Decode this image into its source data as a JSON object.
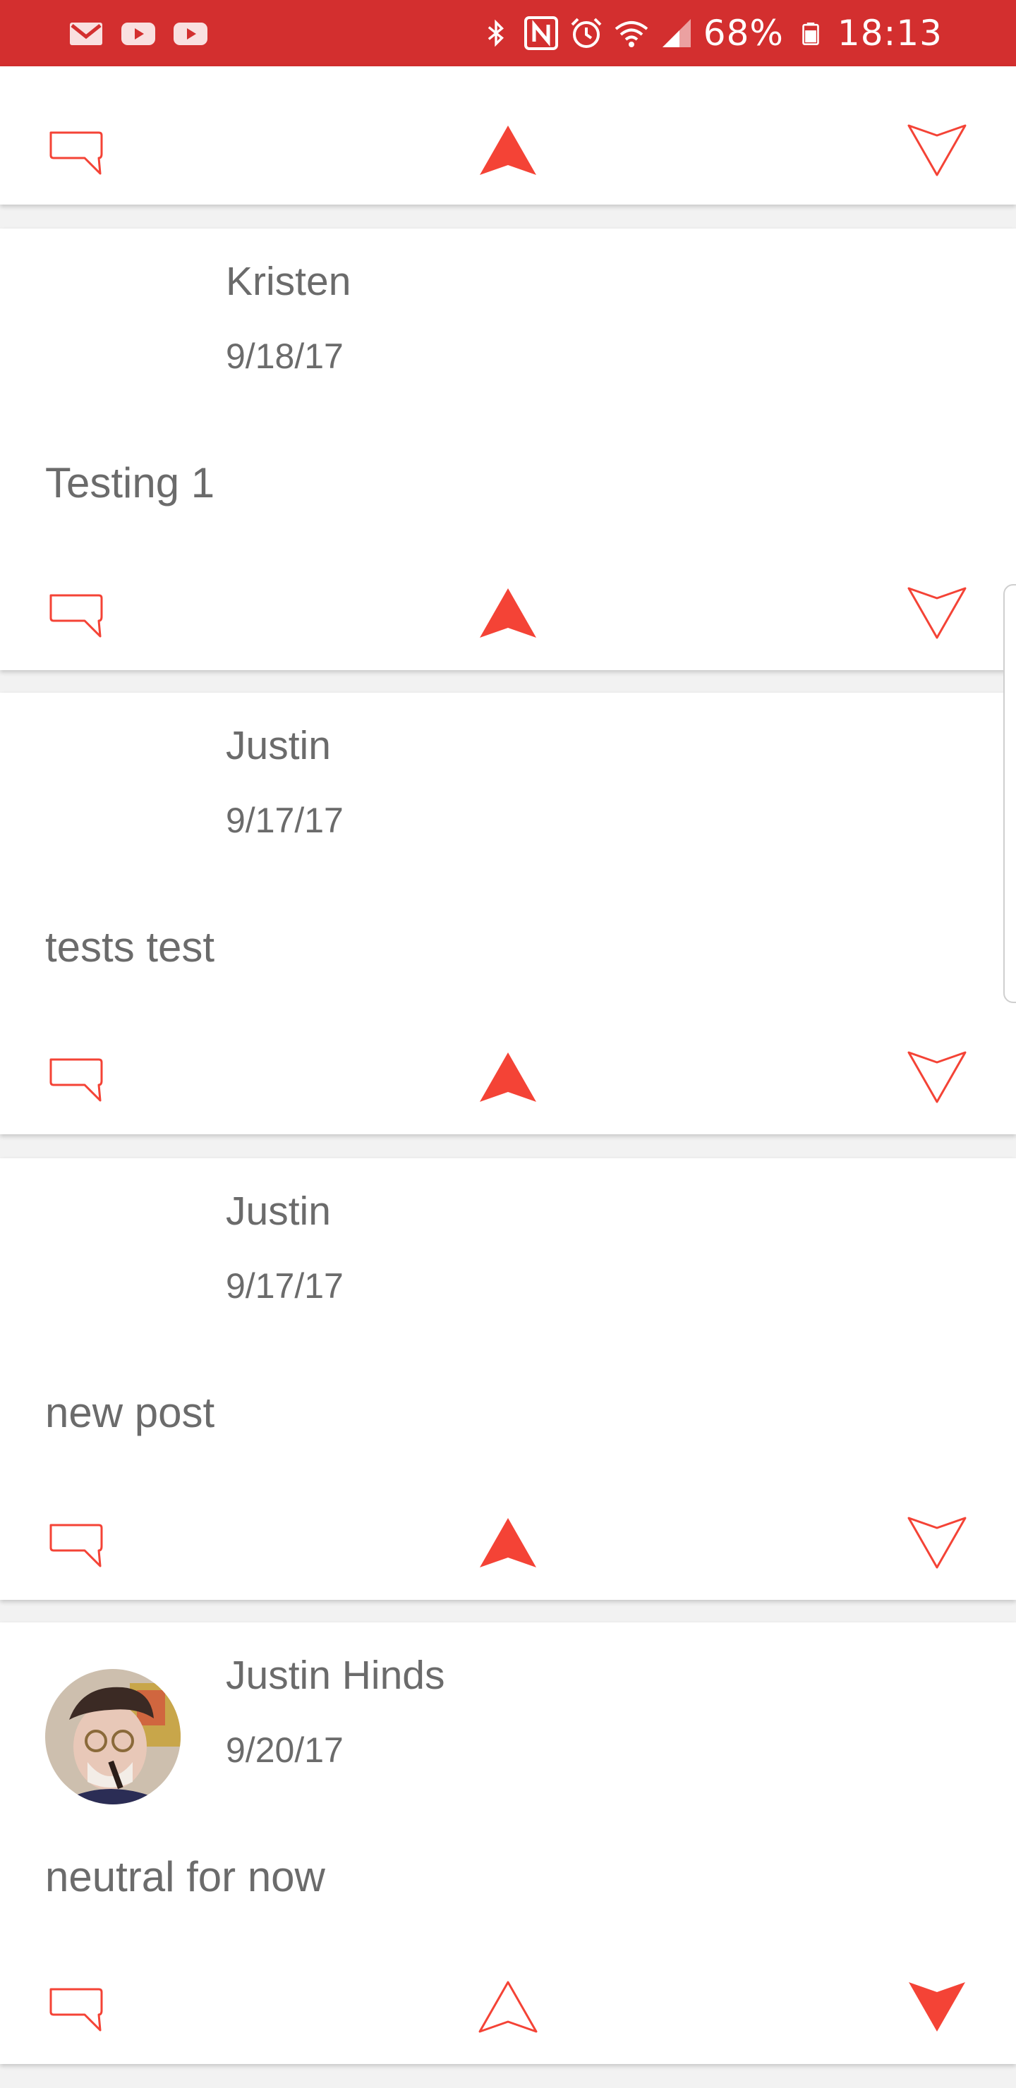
{
  "status_bar": {
    "battery": "68%",
    "time": "18:13",
    "icons": [
      "gmail-icon",
      "youtube-icon",
      "youtube-icon",
      "bluetooth-icon",
      "nfc-icon",
      "alarm-icon",
      "wifi-icon",
      "signal-icon",
      "battery-icon"
    ]
  },
  "colors": {
    "accent": "#f44336",
    "statusbar": "#d32f2f",
    "text": "#6b6b6b"
  },
  "posts": [
    {
      "author": "",
      "date": "",
      "text": "",
      "vote": "up"
    },
    {
      "author": "Kristen",
      "date": "9/18/17",
      "text": "Testing 1",
      "vote": "up"
    },
    {
      "author": "Justin",
      "date": "9/17/17",
      "text": "tests test",
      "vote": "up"
    },
    {
      "author": "Justin",
      "date": "9/17/17",
      "text": "new post",
      "vote": "up"
    },
    {
      "author": "Justin Hinds",
      "date": "9/20/17",
      "text": "neutral for now",
      "vote": "down",
      "has_avatar": true
    }
  ]
}
